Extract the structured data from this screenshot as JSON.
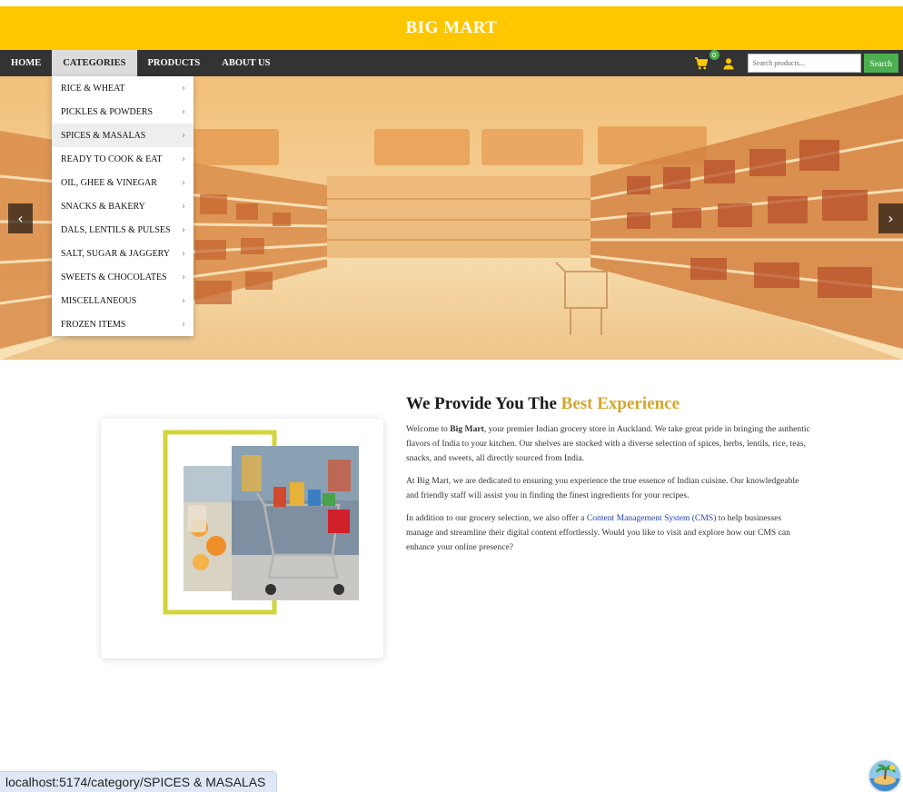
{
  "brand": {
    "name": "BIG MART"
  },
  "nav": {
    "items": [
      "HOME",
      "CATEGORIES",
      "PRODUCTS",
      "ABOUT US"
    ],
    "active": "CATEGORIES",
    "cart_count": "0",
    "search_placeholder": "Search products...",
    "search_button": "Search"
  },
  "categories": [
    "RICE & WHEAT",
    "PICKLES & POWDERS",
    "SPICES & MASALAS",
    "READY TO COOK & EAT",
    "OIL, GHEE & VINEGAR",
    "SNACKS & BAKERY",
    "DALS, LENTILS & PULSES",
    "SALT, SUGAR & JAGGERY",
    "SWEETS & CHOCOLATES",
    "MISCELLANEOUS",
    "FROZEN ITEMS"
  ],
  "hovered_category": "SPICES & MASALAS",
  "hero": {
    "prev": "‹",
    "next": "›"
  },
  "about": {
    "heading_plain": "We Provide You The ",
    "heading_highlight": "Best Experience",
    "p1_a": "Welcome to ",
    "p1_bold": "Big Mart",
    "p1_b": ", your premier Indian grocery store in Auckland. We take great pride in bringing the authentic flavors of India to your kitchen. Our shelves are stocked with a diverse selection of spices, herbs, lentils, rice, teas, snacks, and sweets, all directly sourced from India.",
    "p2": "At Big Mart, we are dedicated to ensuring you experience the true essence of Indian cuisine. Our knowledgeable and friendly staff will assist you in finding the finest ingredients for your recipes.",
    "p3_a": "In addition to our grocery selection, we also offer a ",
    "p3_link": "Content Management System (CMS)",
    "p3_b": " to help businesses manage and streamline their digital content effortlessly. Would you like to visit and explore how our CMS can enhance your online presence?"
  },
  "status_url": "localhost:5174/category/SPICES & MASALAS",
  "colors": {
    "brand_yellow": "#ffc700",
    "nav_dark": "#333333",
    "accent_gold": "#d4a72c",
    "search_green": "#4caf50",
    "link_blue": "#1e3fb8"
  }
}
